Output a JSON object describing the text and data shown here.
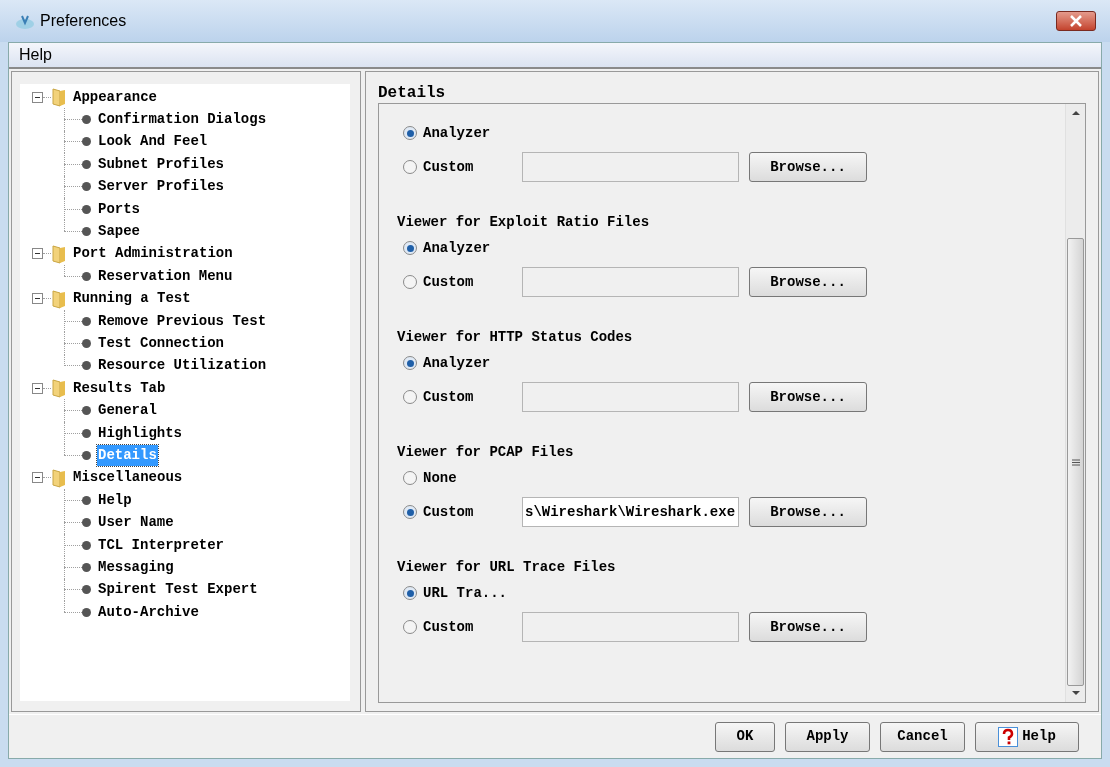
{
  "window": {
    "title": "Preferences"
  },
  "menu": [
    "Help"
  ],
  "tree": [
    {
      "label": "Appearance",
      "expanded": true,
      "selected": false,
      "children": [
        {
          "label": "Confirmation Dialogs",
          "selected": false
        },
        {
          "label": "Look And Feel",
          "selected": false
        },
        {
          "label": "Subnet Profiles",
          "selected": false
        },
        {
          "label": "Server Profiles",
          "selected": false
        },
        {
          "label": "Ports",
          "selected": false
        },
        {
          "label": "Sapee",
          "selected": false
        }
      ]
    },
    {
      "label": "Port Administration",
      "expanded": true,
      "selected": false,
      "children": [
        {
          "label": "Reservation Menu",
          "selected": false
        }
      ]
    },
    {
      "label": "Running a Test",
      "expanded": true,
      "selected": false,
      "children": [
        {
          "label": "Remove Previous Test",
          "selected": false
        },
        {
          "label": "Test Connection",
          "selected": false
        },
        {
          "label": "Resource Utilization",
          "selected": false
        }
      ]
    },
    {
      "label": "Results Tab",
      "expanded": true,
      "selected": false,
      "children": [
        {
          "label": "General",
          "selected": false
        },
        {
          "label": "Highlights",
          "selected": false
        },
        {
          "label": "Details",
          "selected": true
        }
      ]
    },
    {
      "label": "Miscellaneous",
      "expanded": true,
      "selected": false,
      "children": [
        {
          "label": "Help",
          "selected": false
        },
        {
          "label": "User Name",
          "selected": false
        },
        {
          "label": "TCL Interpreter",
          "selected": false
        },
        {
          "label": "Messaging",
          "selected": false
        },
        {
          "label": "Spirent Test Expert",
          "selected": false
        },
        {
          "label": "Auto-Archive",
          "selected": false
        }
      ]
    }
  ],
  "panel": {
    "title": "Details",
    "sections": [
      {
        "options": [
          {
            "kind": "plain",
            "label": "Analyzer",
            "selected": true
          },
          {
            "kind": "path",
            "label": "Custom",
            "selected": false,
            "button": "Browse..."
          }
        ]
      },
      {
        "title": "Viewer for Exploit Ratio Files",
        "options": [
          {
            "kind": "plain",
            "label": "Analyzer",
            "selected": true
          },
          {
            "kind": "path",
            "label": "Custom",
            "selected": false,
            "button": "Browse..."
          }
        ]
      },
      {
        "title": "Viewer for HTTP Status Codes",
        "options": [
          {
            "kind": "plain",
            "label": "Analyzer",
            "selected": true
          },
          {
            "kind": "path",
            "label": "Custom",
            "selected": false,
            "button": "Browse..."
          }
        ]
      },
      {
        "title": "Viewer for PCAP Files",
        "options": [
          {
            "kind": "plain",
            "label": "None",
            "selected": false
          },
          {
            "kind": "path",
            "label": "Custom",
            "selected": true,
            "value": "s\\Wireshark\\Wireshark.exe",
            "button": "Browse..."
          }
        ]
      },
      {
        "title": "Viewer for URL Trace Files",
        "options": [
          {
            "kind": "plain",
            "label": "URL Tra...",
            "selected": true
          },
          {
            "kind": "path",
            "label": "Custom",
            "selected": false,
            "button": "Browse..."
          }
        ]
      }
    ]
  },
  "buttons": [
    {
      "kind": "plain",
      "label": "OK"
    },
    {
      "kind": "plain",
      "label": "Apply"
    },
    {
      "kind": "plain",
      "label": "Cancel"
    },
    {
      "kind": "help",
      "label": "Help"
    }
  ]
}
